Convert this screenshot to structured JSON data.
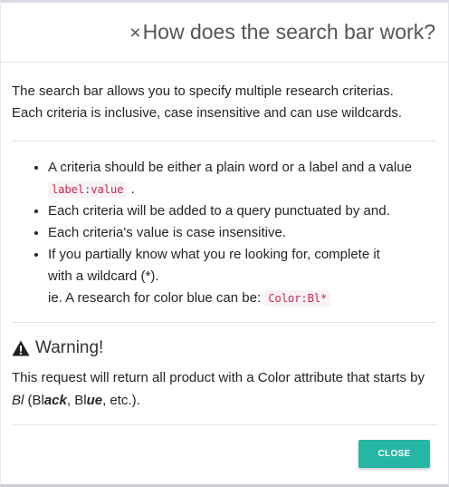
{
  "header": {
    "close_icon": "×",
    "title": "How does the search bar work?"
  },
  "intro": {
    "line1": "The search bar allows you to specify multiple research criterias.",
    "line2": "Each criteria is inclusive, case insensitive and can use wildcards."
  },
  "rules": {
    "item1": "A criteria should be either a plain word or a label and a value",
    "item1_code": "label:value",
    "item1_end": ".",
    "item2": "Each criteria will be added to a query punctuated by and.",
    "item3": "Each criteria's value is case insensitive.",
    "item4_line1": "If you partially know what you re looking for, complete it",
    "item4_line2": "with a wildcard (*).",
    "item4_line3": "ie. A research for color blue can be:",
    "item4_code": "Color:Bl*"
  },
  "warning": {
    "icon": "warning-icon",
    "title": "Warning!",
    "text_a": "This request will return all product with a Color attribute that starts by ",
    "text_bl": "Bl",
    "text_b": " (Bl",
    "text_ack": "ack",
    "text_c": ", Bl",
    "text_ue": "ue",
    "text_d": ", etc.)."
  },
  "footer": {
    "close_label": "CLOSE"
  },
  "colors": {
    "accent": "#26b6a6",
    "code_text": "#c7254e",
    "code_bg": "#f9f2f4"
  }
}
